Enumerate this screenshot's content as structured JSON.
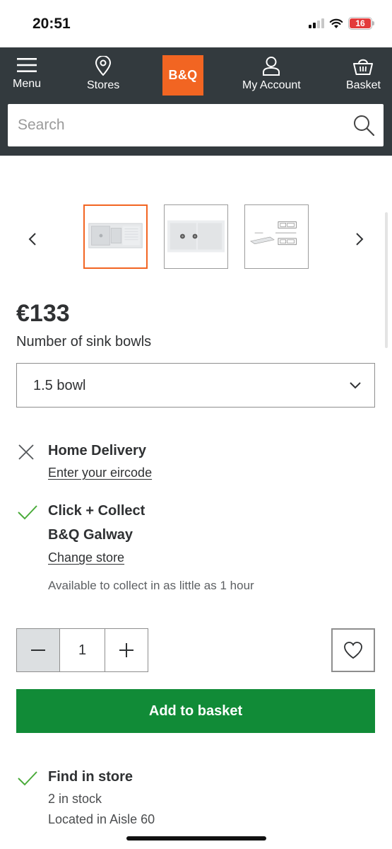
{
  "status_bar": {
    "time": "20:51",
    "battery": "16",
    "icons": [
      "signal-icon",
      "wifi-icon",
      "battery-icon"
    ]
  },
  "nav": {
    "menu_label": "Menu",
    "stores_label": "Stores",
    "logo_text": "B&Q",
    "account_label": "My Account",
    "basket_label": "Basket",
    "icons": [
      "hamburger-icon",
      "location-pin-icon",
      "user-icon",
      "basket-icon"
    ]
  },
  "search": {
    "placeholder": "Search"
  },
  "gallery": {
    "thumbnails": [
      "sink-top-view",
      "sink-double-bowl",
      "sink-dimension-drawing"
    ],
    "selected_index": 0
  },
  "product": {
    "price": "€133",
    "option_label": "Number of sink bowls",
    "option_value": "1.5 bowl"
  },
  "delivery": {
    "home_title": "Home Delivery",
    "home_link": "Enter your eircode",
    "home_available": false,
    "collect_title": "Click + Collect",
    "collect_store": "B&Q Galway",
    "collect_link": "Change store",
    "collect_note": "Available to collect in as little as 1 hour",
    "collect_available": true
  },
  "purchase": {
    "quantity": "1",
    "add_label": "Add to basket"
  },
  "find_in_store": {
    "title": "Find in store",
    "stock": "2 in stock",
    "location": "Located in Aisle 60"
  },
  "colors": {
    "header": "#333a3e",
    "brand": "#f26522",
    "add_button": "#118b37",
    "check": "#4aab3a"
  }
}
